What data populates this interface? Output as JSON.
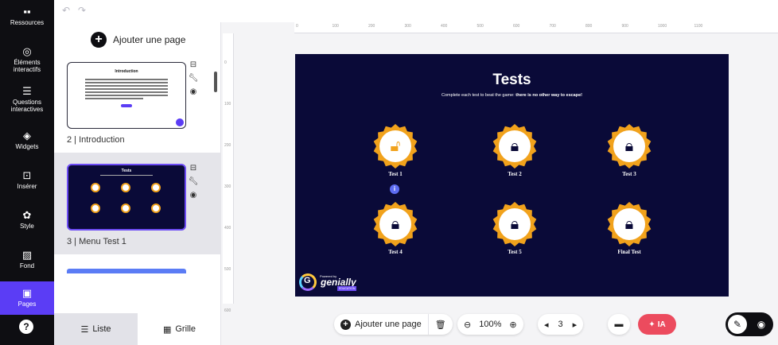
{
  "sidebar": {
    "items": [
      {
        "label": "Ressources",
        "icon": "resources-icon",
        "glyph": "▪▪"
      },
      {
        "label": "Éléments interactifs",
        "icon": "interactive-elements-icon",
        "glyph": "◎"
      },
      {
        "label": "Questions interactives",
        "icon": "interactive-questions-icon",
        "glyph": "☰"
      },
      {
        "label": "Widgets",
        "icon": "widgets-icon",
        "glyph": "◈"
      },
      {
        "label": "Insérer",
        "icon": "insert-icon",
        "glyph": "⊡"
      },
      {
        "label": "Style",
        "icon": "style-icon",
        "glyph": "✿"
      },
      {
        "label": "Fond",
        "icon": "background-icon",
        "glyph": "▨"
      },
      {
        "label": "Pages",
        "icon": "pages-icon",
        "glyph": "▣",
        "active": true
      }
    ],
    "help": "?"
  },
  "toolbar_top": {
    "undo": "↶",
    "redo": "↷"
  },
  "page_panel": {
    "add_page_label": "Ajouter une page",
    "pages": [
      {
        "label": "2 | Introduction",
        "thumb_title": "Introduction"
      },
      {
        "label": "3 | Menu Test 1",
        "thumb_title": "Tests",
        "selected": true
      }
    ],
    "tabs": [
      {
        "label": "Liste",
        "icon": "list-icon",
        "active": true
      },
      {
        "label": "Grille",
        "icon": "grid-icon",
        "active": false
      }
    ]
  },
  "ruler_top": [
    "0",
    "100",
    "200",
    "300",
    "400",
    "500",
    "600",
    "700",
    "800",
    "900",
    "1000",
    "1100"
  ],
  "ruler_left": [
    "0",
    "100",
    "200",
    "300",
    "400",
    "500",
    "600"
  ],
  "slide": {
    "title": "Tests",
    "subtitle_plain": "Complete each test to beat the game: ",
    "subtitle_bold": "there is no other way to escape!",
    "badges": [
      {
        "label": "Test 1",
        "state": "unlocked"
      },
      {
        "label": "Test 2",
        "state": "locked"
      },
      {
        "label": "Test 3",
        "state": "locked"
      },
      {
        "label": "Test 4",
        "state": "locked"
      },
      {
        "label": "Test 5",
        "state": "locked"
      },
      {
        "label": "Final Test",
        "state": "locked"
      }
    ],
    "info_marker": "i",
    "logo": {
      "powered": "Powered by",
      "name": "genially",
      "edition": "EDUCATION"
    }
  },
  "bottom_bar": {
    "add_page_label": "Ajouter une page",
    "zoom_value": "100%",
    "page_number": "3",
    "ia_label": "IA"
  },
  "colors": {
    "slide_bg": "#0a0a38",
    "badge_gold": "#f1a21c",
    "accent_purple": "#5b3df5",
    "ia_red": "#ec4b5e"
  }
}
